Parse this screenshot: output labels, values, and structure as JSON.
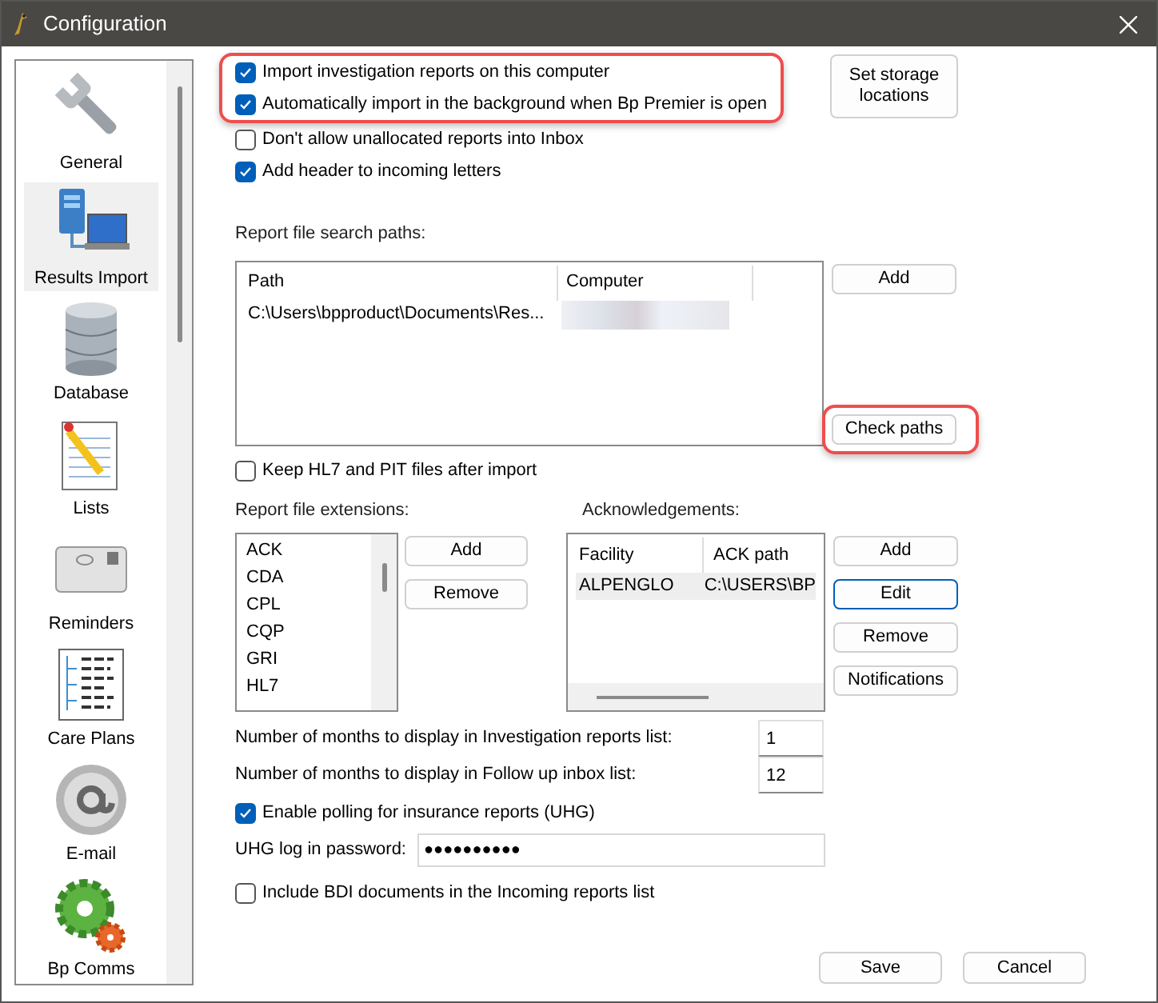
{
  "window": {
    "title": "Configuration"
  },
  "sidebar": {
    "items": [
      {
        "label": "General",
        "selected": false,
        "kind": "wrench"
      },
      {
        "label": "Results Import",
        "selected": true,
        "kind": "network"
      },
      {
        "label": "Database",
        "selected": false,
        "kind": "database"
      },
      {
        "label": "Lists",
        "selected": false,
        "kind": "notepad"
      },
      {
        "label": "Reminders",
        "selected": false,
        "kind": "envelope"
      },
      {
        "label": "Care Plans",
        "selected": false,
        "kind": "tree"
      },
      {
        "label": "E-mail",
        "selected": false,
        "kind": "at"
      },
      {
        "label": "Bp Comms",
        "selected": false,
        "kind": "gear"
      }
    ]
  },
  "import_options": [
    {
      "label": "Import investigation reports on this computer",
      "checked": true,
      "highlighted": true
    },
    {
      "label": "Automatically import in the background when Bp Premier is open",
      "checked": true,
      "highlighted": true
    },
    {
      "label": "Don't allow unallocated reports into Inbox",
      "checked": false,
      "highlighted": false
    },
    {
      "label": "Add header to incoming letters",
      "checked": true,
      "highlighted": false
    }
  ],
  "storage_button": {
    "label": "Set storage locations"
  },
  "search_paths": {
    "label": "Report file search paths:",
    "columns": [
      "Path",
      "Computer"
    ],
    "rows": [
      {
        "path": "C:\\Users\\bpproduct\\Documents\\Res..."
      }
    ],
    "buttons": [
      {
        "label": "Add",
        "highlighted": false
      },
      {
        "label": "Check paths",
        "highlighted": true
      }
    ]
  },
  "keep_files": {
    "label": "Keep HL7 and PIT files after import",
    "checked": false
  },
  "extensions": {
    "label": "Report file extensions:",
    "items": [
      "ACK",
      "CDA",
      "CPL",
      "CQP",
      "GRI",
      "HL7"
    ],
    "buttons": [
      "Add",
      "Remove"
    ]
  },
  "acknowledgements": {
    "label": "Acknowledgements:",
    "columns": [
      "Facility",
      "ACK path"
    ],
    "rows": [
      {
        "facility": "ALPENGLO",
        "path": "C:\\USERS\\BP"
      }
    ],
    "buttons": [
      {
        "label": "Add",
        "focused": false
      },
      {
        "label": "Edit",
        "focused": true
      },
      {
        "label": "Remove",
        "focused": false
      },
      {
        "label": "Notifications",
        "focused": false
      }
    ]
  },
  "months": [
    {
      "label": "Number of months to display in Investigation reports list:",
      "value": "1"
    },
    {
      "label": "Number of months to display in Follow up inbox list:",
      "value": "12"
    }
  ],
  "polling": {
    "label": "Enable polling for insurance reports (UHG)",
    "checked": true
  },
  "password": {
    "label": "UHG log in password:",
    "value": "●●●●●●●●●●"
  },
  "bdi": {
    "label": "Include BDI documents in the Incoming reports list",
    "checked": false
  },
  "footer_buttons": [
    "Save",
    "Cancel"
  ]
}
